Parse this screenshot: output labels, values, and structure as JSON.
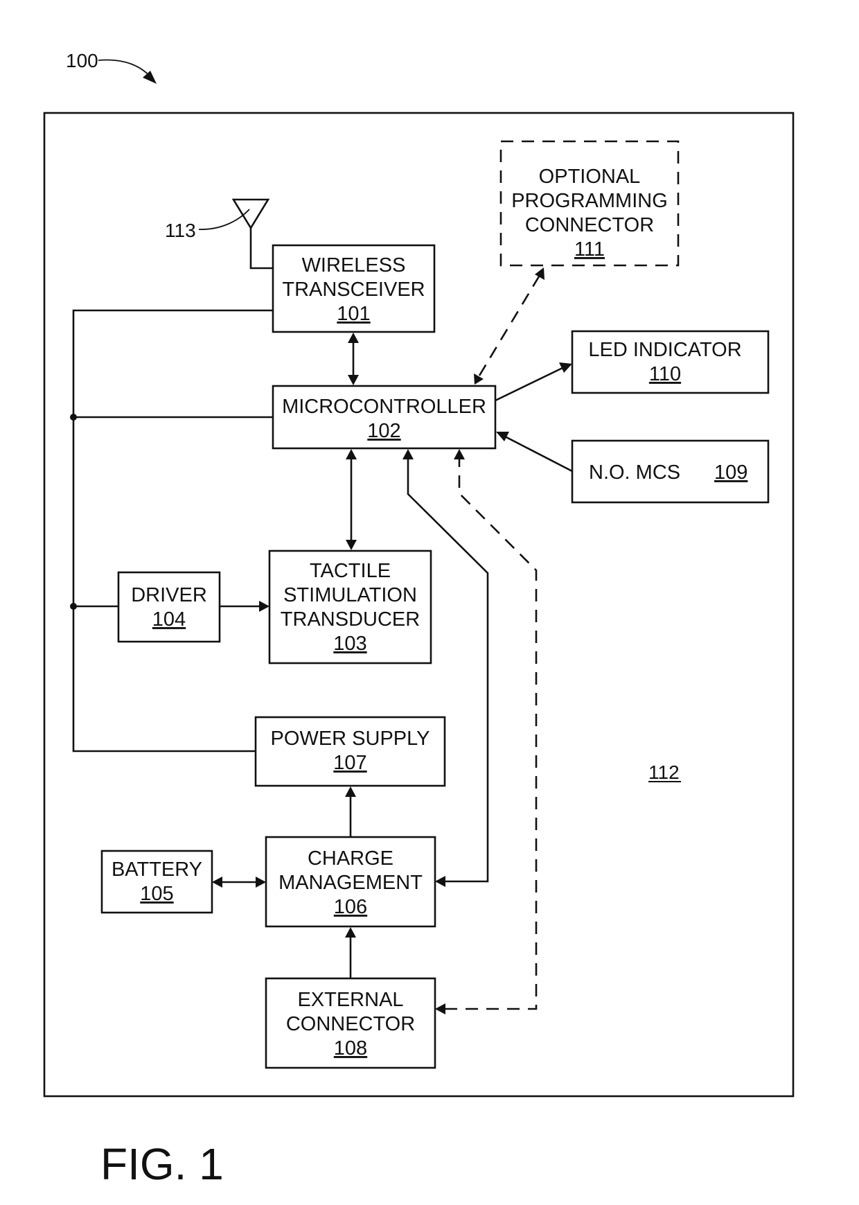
{
  "figure": {
    "ref_label": "100",
    "caption": "FIG. 1",
    "housing_ref": "112",
    "antenna_ref": "113"
  },
  "blocks": {
    "wireless": {
      "lines": [
        "WIRELESS",
        "TRANSCEIVER"
      ],
      "ref": "101"
    },
    "micro": {
      "lines": [
        "MICROCONTROLLER"
      ],
      "ref": "102"
    },
    "tactile": {
      "lines": [
        "TACTILE",
        "STIMULATION",
        "TRANSDUCER"
      ],
      "ref": "103"
    },
    "driver": {
      "lines": [
        "DRIVER"
      ],
      "ref": "104"
    },
    "battery": {
      "lines": [
        "BATTERY"
      ],
      "ref": "105"
    },
    "charge": {
      "lines": [
        "CHARGE",
        "MANAGEMENT"
      ],
      "ref": "106"
    },
    "power": {
      "lines": [
        "POWER SUPPLY"
      ],
      "ref": "107"
    },
    "external": {
      "lines": [
        "EXTERNAL",
        "CONNECTOR"
      ],
      "ref": "108"
    },
    "mcs": {
      "lines": [
        "N.O. MCS"
      ],
      "ref": "109"
    },
    "led": {
      "lines": [
        "LED INDICATOR"
      ],
      "ref": "110"
    },
    "optional": {
      "lines": [
        "OPTIONAL",
        "PROGRAMMING",
        "CONNECTOR"
      ],
      "ref": "111",
      "style": "dashed"
    }
  },
  "connections": [
    {
      "from": "wireless",
      "to": "micro",
      "type": "bidirectional"
    },
    {
      "from": "micro",
      "to": "tactile",
      "type": "bidirectional"
    },
    {
      "from": "driver",
      "to": "tactile",
      "type": "directed"
    },
    {
      "from": "micro",
      "to": "led",
      "type": "directed"
    },
    {
      "from": "mcs",
      "to": "micro",
      "type": "directed"
    },
    {
      "from": "optional",
      "to": "micro",
      "type": "bidirectional",
      "style": "dashed"
    },
    {
      "from": "charge",
      "to": "power",
      "type": "directed"
    },
    {
      "from": "battery",
      "to": "charge",
      "type": "bidirectional"
    },
    {
      "from": "external",
      "to": "charge",
      "type": "directed"
    },
    {
      "from": "charge",
      "to": "micro",
      "type": "directed"
    },
    {
      "from": "micro",
      "to": "external",
      "type": "directed",
      "style": "dashed"
    },
    {
      "from": "power",
      "to": "bus",
      "type": "line",
      "targets": [
        "wireless",
        "micro",
        "driver"
      ]
    },
    {
      "from": "antenna",
      "to": "wireless",
      "type": "line"
    }
  ]
}
